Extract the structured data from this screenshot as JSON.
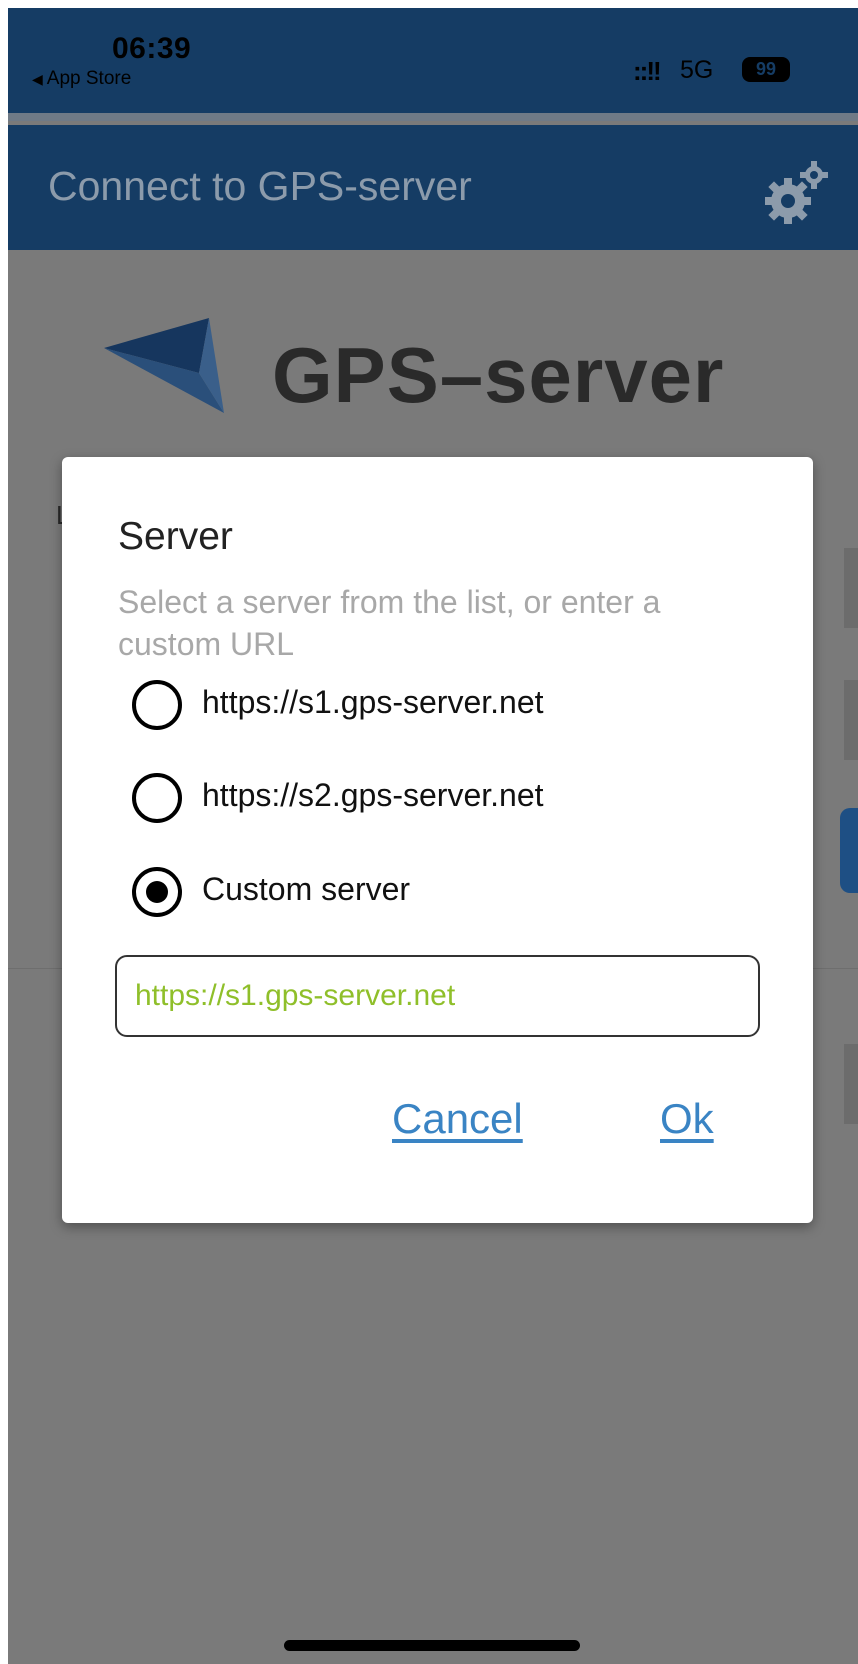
{
  "status_bar": {
    "time": "06:39",
    "back_app": "App Store",
    "back_arrow": "◀",
    "signal": "::!!",
    "network": "5G",
    "battery": "99"
  },
  "header": {
    "title": "Connect to GPS-server",
    "settings_icon": "gears-icon"
  },
  "background": {
    "logo_text": "GPS–server",
    "login_label": "L"
  },
  "dialog": {
    "title": "Server",
    "subtitle": "Select a server from the list, or enter a custom URL",
    "options": [
      {
        "label": "https://s1.gps-server.net",
        "selected": false
      },
      {
        "label": "https://s2.gps-server.net",
        "selected": false
      },
      {
        "label": "Custom server",
        "selected": true
      }
    ],
    "custom_url_value": "https://s1.gps-server.net",
    "cancel_label": "Cancel",
    "ok_label": "Ok"
  },
  "colors": {
    "header_bg": "#153c64",
    "link": "#3a84c4",
    "input_text": "#8fbf2a",
    "overlay": "#7a7a7a"
  }
}
